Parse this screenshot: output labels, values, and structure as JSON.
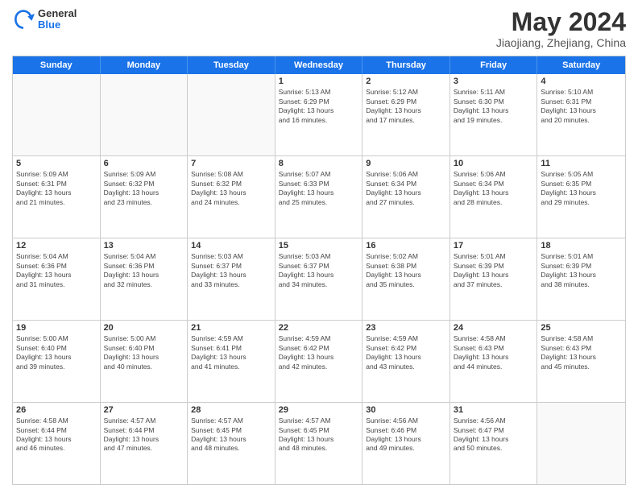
{
  "logo": {
    "general": "General",
    "blue": "Blue"
  },
  "title": "May 2024",
  "subtitle": "Jiaojiang, Zhejiang, China",
  "days_of_week": [
    "Sunday",
    "Monday",
    "Tuesday",
    "Wednesday",
    "Thursday",
    "Friday",
    "Saturday"
  ],
  "weeks": [
    [
      {
        "day": "",
        "info": ""
      },
      {
        "day": "",
        "info": ""
      },
      {
        "day": "",
        "info": ""
      },
      {
        "day": "1",
        "info": "Sunrise: 5:13 AM\nSunset: 6:29 PM\nDaylight: 13 hours\nand 16 minutes."
      },
      {
        "day": "2",
        "info": "Sunrise: 5:12 AM\nSunset: 6:29 PM\nDaylight: 13 hours\nand 17 minutes."
      },
      {
        "day": "3",
        "info": "Sunrise: 5:11 AM\nSunset: 6:30 PM\nDaylight: 13 hours\nand 19 minutes."
      },
      {
        "day": "4",
        "info": "Sunrise: 5:10 AM\nSunset: 6:31 PM\nDaylight: 13 hours\nand 20 minutes."
      }
    ],
    [
      {
        "day": "5",
        "info": "Sunrise: 5:09 AM\nSunset: 6:31 PM\nDaylight: 13 hours\nand 21 minutes."
      },
      {
        "day": "6",
        "info": "Sunrise: 5:09 AM\nSunset: 6:32 PM\nDaylight: 13 hours\nand 23 minutes."
      },
      {
        "day": "7",
        "info": "Sunrise: 5:08 AM\nSunset: 6:32 PM\nDaylight: 13 hours\nand 24 minutes."
      },
      {
        "day": "8",
        "info": "Sunrise: 5:07 AM\nSunset: 6:33 PM\nDaylight: 13 hours\nand 25 minutes."
      },
      {
        "day": "9",
        "info": "Sunrise: 5:06 AM\nSunset: 6:34 PM\nDaylight: 13 hours\nand 27 minutes."
      },
      {
        "day": "10",
        "info": "Sunrise: 5:06 AM\nSunset: 6:34 PM\nDaylight: 13 hours\nand 28 minutes."
      },
      {
        "day": "11",
        "info": "Sunrise: 5:05 AM\nSunset: 6:35 PM\nDaylight: 13 hours\nand 29 minutes."
      }
    ],
    [
      {
        "day": "12",
        "info": "Sunrise: 5:04 AM\nSunset: 6:36 PM\nDaylight: 13 hours\nand 31 minutes."
      },
      {
        "day": "13",
        "info": "Sunrise: 5:04 AM\nSunset: 6:36 PM\nDaylight: 13 hours\nand 32 minutes."
      },
      {
        "day": "14",
        "info": "Sunrise: 5:03 AM\nSunset: 6:37 PM\nDaylight: 13 hours\nand 33 minutes."
      },
      {
        "day": "15",
        "info": "Sunrise: 5:03 AM\nSunset: 6:37 PM\nDaylight: 13 hours\nand 34 minutes."
      },
      {
        "day": "16",
        "info": "Sunrise: 5:02 AM\nSunset: 6:38 PM\nDaylight: 13 hours\nand 35 minutes."
      },
      {
        "day": "17",
        "info": "Sunrise: 5:01 AM\nSunset: 6:39 PM\nDaylight: 13 hours\nand 37 minutes."
      },
      {
        "day": "18",
        "info": "Sunrise: 5:01 AM\nSunset: 6:39 PM\nDaylight: 13 hours\nand 38 minutes."
      }
    ],
    [
      {
        "day": "19",
        "info": "Sunrise: 5:00 AM\nSunset: 6:40 PM\nDaylight: 13 hours\nand 39 minutes."
      },
      {
        "day": "20",
        "info": "Sunrise: 5:00 AM\nSunset: 6:40 PM\nDaylight: 13 hours\nand 40 minutes."
      },
      {
        "day": "21",
        "info": "Sunrise: 4:59 AM\nSunset: 6:41 PM\nDaylight: 13 hours\nand 41 minutes."
      },
      {
        "day": "22",
        "info": "Sunrise: 4:59 AM\nSunset: 6:42 PM\nDaylight: 13 hours\nand 42 minutes."
      },
      {
        "day": "23",
        "info": "Sunrise: 4:59 AM\nSunset: 6:42 PM\nDaylight: 13 hours\nand 43 minutes."
      },
      {
        "day": "24",
        "info": "Sunrise: 4:58 AM\nSunset: 6:43 PM\nDaylight: 13 hours\nand 44 minutes."
      },
      {
        "day": "25",
        "info": "Sunrise: 4:58 AM\nSunset: 6:43 PM\nDaylight: 13 hours\nand 45 minutes."
      }
    ],
    [
      {
        "day": "26",
        "info": "Sunrise: 4:58 AM\nSunset: 6:44 PM\nDaylight: 13 hours\nand 46 minutes."
      },
      {
        "day": "27",
        "info": "Sunrise: 4:57 AM\nSunset: 6:44 PM\nDaylight: 13 hours\nand 47 minutes."
      },
      {
        "day": "28",
        "info": "Sunrise: 4:57 AM\nSunset: 6:45 PM\nDaylight: 13 hours\nand 48 minutes."
      },
      {
        "day": "29",
        "info": "Sunrise: 4:57 AM\nSunset: 6:45 PM\nDaylight: 13 hours\nand 48 minutes."
      },
      {
        "day": "30",
        "info": "Sunrise: 4:56 AM\nSunset: 6:46 PM\nDaylight: 13 hours\nand 49 minutes."
      },
      {
        "day": "31",
        "info": "Sunrise: 4:56 AM\nSunset: 6:47 PM\nDaylight: 13 hours\nand 50 minutes."
      },
      {
        "day": "",
        "info": ""
      }
    ]
  ]
}
